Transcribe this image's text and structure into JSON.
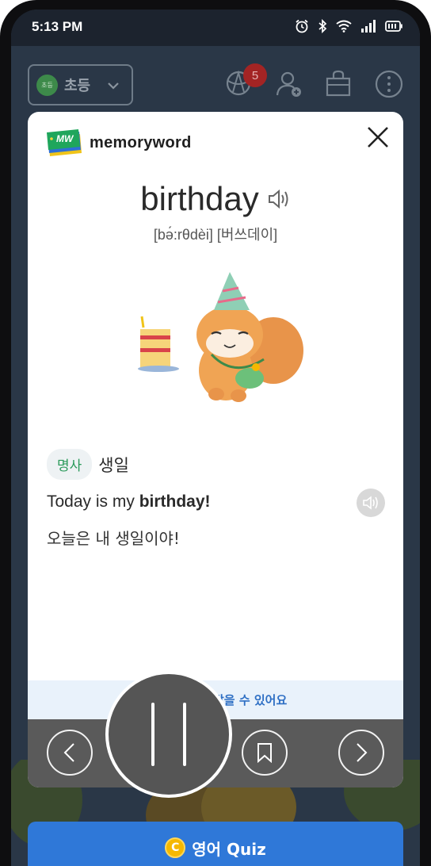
{
  "status_bar": {
    "time": "5:13 PM",
    "icons": [
      "alarm-icon",
      "bluetooth-icon",
      "wifi-icon",
      "signal-icon",
      "battery-icon"
    ]
  },
  "topbar": {
    "grade_badge": "초등",
    "grade_label": "초등",
    "notification_count": "5",
    "icons": [
      "ball-icon",
      "add-user-icon",
      "shop-bag-icon",
      "more-icon"
    ]
  },
  "card": {
    "logo_mark": "MW",
    "logo_text": "memoryword",
    "word": "birthday",
    "phonetic": "[bə́:rθdèi] [버쓰데이]",
    "part_of_speech": "명사",
    "meaning": "생일",
    "example_en_prefix": "Today is my ",
    "example_en_bold": "birthday!",
    "example_ko": "오늘은 내 생일이야!",
    "reward_text": "받을 수 있어요"
  },
  "quiz_button": {
    "coin": "C",
    "label": "영어 Quiz"
  },
  "colors": {
    "accent_blue": "#2f78d8",
    "pos_green": "#2a9a5a",
    "notif_red": "#a32424",
    "controls_gray": "#5a5a5a"
  }
}
